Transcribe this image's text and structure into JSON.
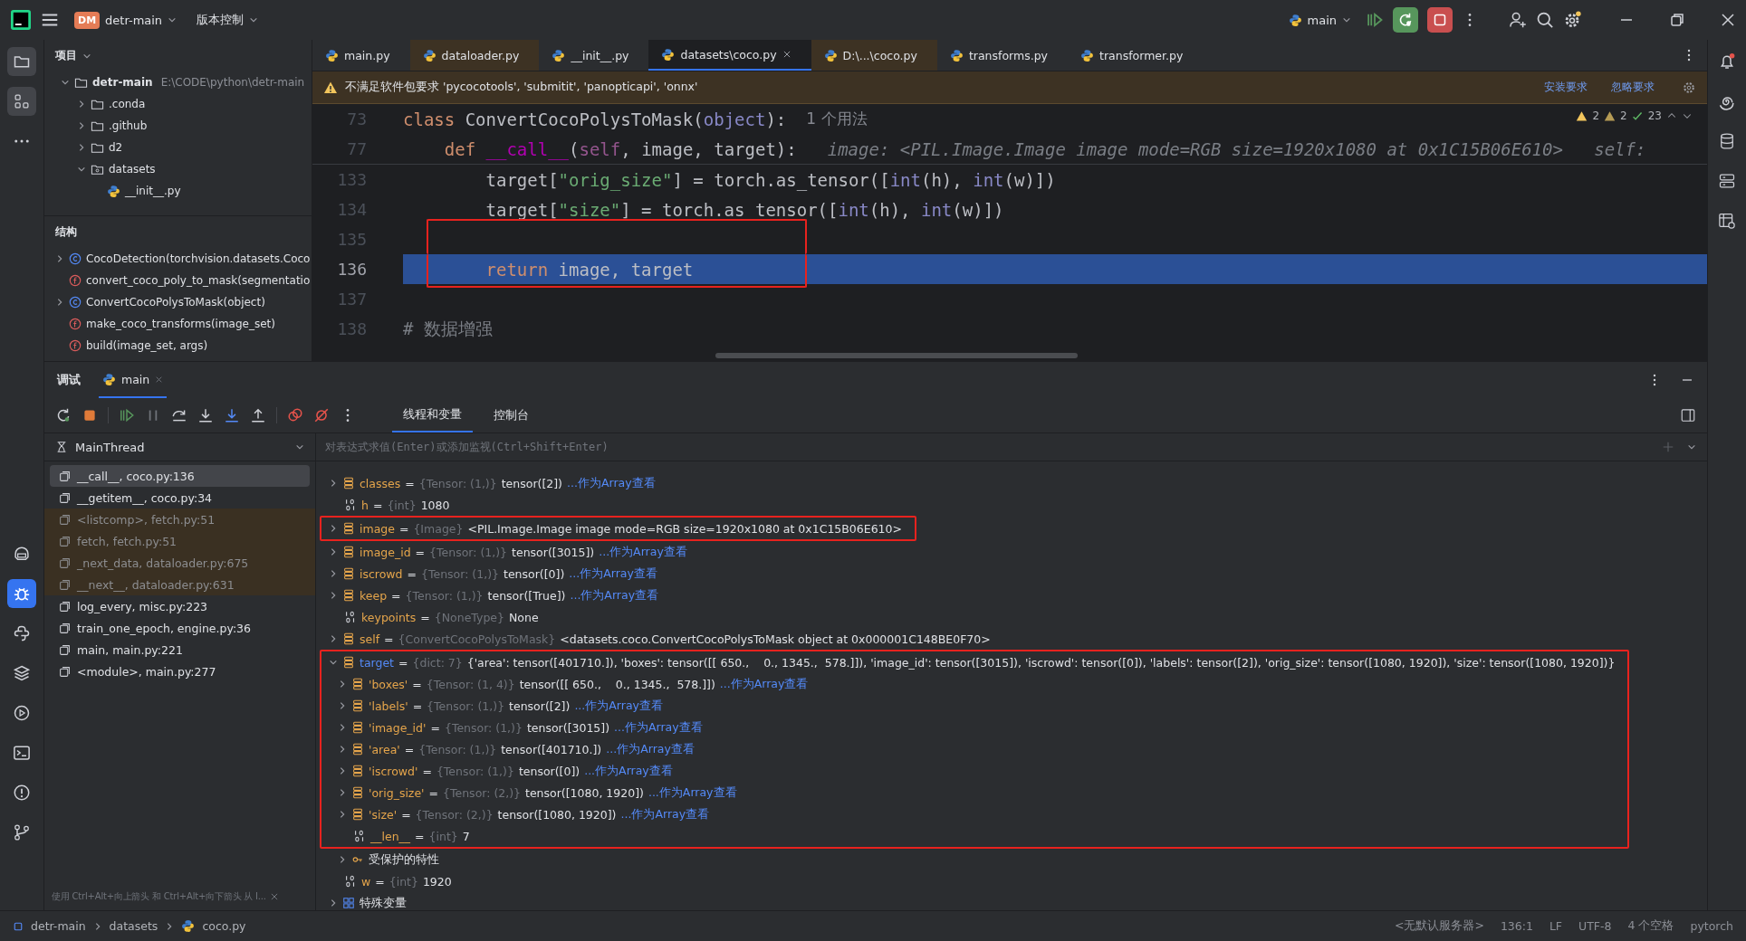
{
  "title_bar": {
    "project_badge": "DM",
    "project": "detr-main",
    "vcs": "版本控制",
    "run_config": "main"
  },
  "left_strip": {
    "top": [
      {
        "kind": "folder",
        "selected": true
      },
      {
        "kind": "structure",
        "selected": true
      },
      {
        "kind": "more",
        "selected": false
      }
    ],
    "bottom": [
      {
        "kind": "assistant",
        "selected": false
      },
      {
        "kind": "debug",
        "selected": true
      },
      {
        "kind": "console",
        "selected": false
      },
      {
        "kind": "layers",
        "selected": false
      },
      {
        "kind": "run",
        "selected": false
      },
      {
        "kind": "terminal",
        "selected": false
      },
      {
        "kind": "problems",
        "selected": false
      },
      {
        "kind": "git",
        "selected": false
      }
    ]
  },
  "right_strip": [
    {
      "kind": "bell"
    },
    {
      "kind": "spiral"
    },
    {
      "kind": "database"
    },
    {
      "kind": "server"
    },
    {
      "kind": "table"
    }
  ],
  "project_panel": {
    "title": "项目",
    "tree": [
      {
        "kind": "folder",
        "label": "detr-main",
        "path": "E:\\CODE\\python\\detr-main",
        "expanded": true,
        "children": [
          {
            "kind": "folder",
            "label": ".conda",
            "expanded": false
          },
          {
            "kind": "folder",
            "label": ".github",
            "expanded": false
          },
          {
            "kind": "folder",
            "label": "d2",
            "expanded": false
          },
          {
            "kind": "package",
            "label": "datasets",
            "expanded": true,
            "children": [
              {
                "kind": "file",
                "label": "__init__.py"
              }
            ]
          }
        ]
      }
    ]
  },
  "structure_panel": {
    "title": "结构",
    "items": [
      {
        "kind": "class",
        "label": "CocoDetection(torchvision.datasets.Coco",
        "expanded": false
      },
      {
        "kind": "function",
        "label": "convert_coco_poly_to_mask(segmentatio"
      },
      {
        "kind": "class",
        "label": "ConvertCocoPolysToMask(object)",
        "expanded": false
      },
      {
        "kind": "function",
        "label": "make_coco_transforms(image_set)"
      },
      {
        "kind": "function",
        "label": "build(image_set, args)"
      }
    ]
  },
  "editor": {
    "tabs": [
      {
        "label": "main.py",
        "selected": false,
        "library": false
      },
      {
        "label": "dataloader.py",
        "selected": false,
        "library": true
      },
      {
        "label": "__init__.py",
        "selected": false,
        "library": false
      },
      {
        "label": "datasets\\coco.py",
        "selected": true,
        "library": false
      },
      {
        "label": "D:\\...\\coco.py",
        "selected": false,
        "library": true
      },
      {
        "label": "transforms.py",
        "selected": false,
        "library": false
      },
      {
        "label": "transformer.py",
        "selected": false,
        "library": false
      }
    ],
    "banner": {
      "text": "不满足软件包要求 'pycocotools', 'submitit', 'panopticapi', 'onnx'",
      "actions": [
        "安装要求",
        "忽略要求"
      ]
    },
    "inspections": {
      "warnings": "2",
      "weak_warnings": "2",
      "checks": "23"
    },
    "sticky_lines": [
      {
        "number": "73",
        "tokens": [
          {
            "kind": "kw",
            "text": "class"
          },
          {
            "kind": "plain",
            "text": " ConvertCocoPolysToMask("
          },
          {
            "kind": "builtin",
            "text": "object"
          },
          {
            "kind": "plain",
            "text": "):"
          }
        ],
        "hint": {
          "kind": "usages",
          "text": "1 个用法"
        }
      },
      {
        "number": "77",
        "tokens": [
          {
            "kind": "kw",
            "text": "    def "
          },
          {
            "kind": "magic",
            "text": "__call__"
          },
          {
            "kind": "plain",
            "text": "("
          },
          {
            "kind": "self",
            "text": "self"
          },
          {
            "kind": "plain",
            "text": ", image, target):"
          }
        ],
        "hint": {
          "kind": "value",
          "text": "image: <PIL.Image.Image image mode=RGB size=1920x1080 at 0x1C15B06E610>   self:"
        }
      }
    ],
    "lines": [
      {
        "number": "133",
        "current": false,
        "highlight": false,
        "tokens": [
          {
            "kind": "plain",
            "text": "        target["
          },
          {
            "kind": "str",
            "text": "\"orig_size\""
          },
          {
            "kind": "plain",
            "text": "] = torch.as_tensor(["
          },
          {
            "kind": "builtin",
            "text": "int"
          },
          {
            "kind": "plain",
            "text": "(h), "
          },
          {
            "kind": "builtin",
            "text": "int"
          },
          {
            "kind": "plain",
            "text": "(w)])"
          }
        ]
      },
      {
        "number": "134",
        "current": false,
        "highlight": false,
        "tokens": [
          {
            "kind": "plain",
            "text": "        target["
          },
          {
            "kind": "str",
            "text": "\"size\""
          },
          {
            "kind": "plain",
            "text": "] = torch.as_tensor(["
          },
          {
            "kind": "builtin",
            "text": "int"
          },
          {
            "kind": "plain",
            "text": "(h), "
          },
          {
            "kind": "builtin",
            "text": "int"
          },
          {
            "kind": "plain",
            "text": "(w)])"
          }
        ]
      },
      {
        "number": "135",
        "current": false,
        "highlight": true
      },
      {
        "number": "136",
        "current": true,
        "highlight": true,
        "tokens": [
          {
            "kind": "kw",
            "text": "        return"
          },
          {
            "kind": "plain",
            "text": " image, target"
          }
        ]
      },
      {
        "number": "137",
        "current": false,
        "highlight": false
      },
      {
        "number": "138",
        "current": false,
        "highlight": false,
        "tokens": [
          {
            "kind": "comment",
            "text": "# 数据增强"
          }
        ]
      }
    ]
  },
  "debug": {
    "title": "调试",
    "tabs": [
      {
        "label": "main",
        "selected": true
      }
    ],
    "view_tabs": [
      {
        "label": "线程和变量",
        "selected": true
      },
      {
        "label": "控制台",
        "selected": false
      }
    ],
    "thread": "MainThread",
    "eval_placeholder": "对表达式求值(Enter)或添加监视(Ctrl+Shift+Enter)",
    "frames": [
      {
        "label": "__call__, coco.py:136",
        "selected": true,
        "library": false
      },
      {
        "label": "__getitem__, coco.py:34",
        "selected": false,
        "library": false
      },
      {
        "label": "<listcomp>, fetch.py:51",
        "selected": false,
        "library": true
      },
      {
        "label": "fetch, fetch.py:51",
        "selected": false,
        "library": true
      },
      {
        "label": "_next_data, dataloader.py:675",
        "selected": false,
        "library": true
      },
      {
        "label": "__next__, dataloader.py:631",
        "selected": false,
        "library": true
      },
      {
        "label": "log_every, misc.py:223",
        "selected": false,
        "library": false
      },
      {
        "label": "train_one_epoch, engine.py:36",
        "selected": false,
        "library": false
      },
      {
        "label": "main, main.py:221",
        "selected": false,
        "library": false
      },
      {
        "label": "<module>, main.py:277",
        "selected": false,
        "library": false
      }
    ],
    "hint": "使用 Ctrl+Alt+向上箭头 和 Ctrl+Alt+向下箭头 从 I...",
    "variables": [
      {
        "name": "classes",
        "operator": "=",
        "type": "{Tensor: (1,)}",
        "value": "tensor([2])",
        "link": "...作为Array查看",
        "kind": "object",
        "expanded": false,
        "changed": false,
        "highlight": false
      },
      {
        "name": "h",
        "operator": "=",
        "type": "{int}",
        "value": "1080",
        "kind": "scalar",
        "changed": false,
        "highlight": false
      },
      {
        "name": "image",
        "operator": "=",
        "type": "{Image}",
        "value": "<PIL.Image.Image image mode=RGB size=1920x1080 at 0x1C15B06E610>",
        "kind": "object",
        "expanded": false,
        "changed": false,
        "highlight": true
      },
      {
        "name": "image_id",
        "operator": "=",
        "type": "{Tensor: (1,)}",
        "value": "tensor([3015])",
        "link": "...作为Array查看",
        "kind": "object",
        "expanded": false,
        "changed": false,
        "highlight": false
      },
      {
        "name": "iscrowd",
        "operator": "=",
        "type": "{Tensor: (1,)}",
        "value": "tensor([0])",
        "link": "...作为Array查看",
        "kind": "object",
        "expanded": false,
        "changed": false,
        "highlight": false
      },
      {
        "name": "keep",
        "operator": "=",
        "type": "{Tensor: (1,)}",
        "value": "tensor([True])",
        "link": "...作为Array查看",
        "kind": "object",
        "expanded": false,
        "changed": false,
        "highlight": false
      },
      {
        "name": "keypoints",
        "operator": "=",
        "type": "{NoneType}",
        "value": "None",
        "kind": "scalar",
        "changed": false,
        "highlight": false
      },
      {
        "name": "self",
        "operator": "=",
        "type": "{ConvertCocoPolysToMask}",
        "value": "<datasets.coco.ConvertCocoPolysToMask object at 0x000001C148BE0F70>",
        "kind": "object",
        "expanded": false,
        "changed": false,
        "highlight": false
      },
      {
        "name": "target",
        "operator": "=",
        "type": "{dict: 7}",
        "value": "{'area': tensor([401710.]), 'boxes': tensor([[ 650.,    0., 1345.,  578.]]), 'image_id': tensor([3015]), 'iscrowd': tensor([0]), 'labels': tensor([2]), 'orig_size': tensor([1080, 1920]), 'size': tensor([1080, 1920])}",
        "kind": "object",
        "expanded": true,
        "changed": true,
        "highlight": true,
        "children": [
          {
            "name": "'boxes'",
            "operator": "=",
            "type": "{Tensor: (1, 4)}",
            "value": "tensor([[ 650.,    0., 1345.,  578.]])",
            "link": "...作为Array查看",
            "kind": "object",
            "expanded": false,
            "changed": false,
            "highlight": true
          },
          {
            "name": "'labels'",
            "operator": "=",
            "type": "{Tensor: (1,)}",
            "value": "tensor([2])",
            "link": "...作为Array查看",
            "kind": "object",
            "expanded": false,
            "changed": false,
            "highlight": true
          },
          {
            "name": "'image_id'",
            "operator": "=",
            "type": "{Tensor: (1,)}",
            "value": "tensor([3015])",
            "link": "...作为Array查看",
            "kind": "object",
            "expanded": false,
            "changed": false,
            "highlight": true
          },
          {
            "name": "'area'",
            "operator": "=",
            "type": "{Tensor: (1,)}",
            "value": "tensor([401710.])",
            "link": "...作为Array查看",
            "kind": "object",
            "expanded": false,
            "changed": false,
            "highlight": true
          },
          {
            "name": "'iscrowd'",
            "operator": "=",
            "type": "{Tensor: (1,)}",
            "value": "tensor([0])",
            "link": "...作为Array查看",
            "kind": "object",
            "expanded": false,
            "changed": false,
            "highlight": true
          },
          {
            "name": "'orig_size'",
            "operator": "=",
            "type": "{Tensor: (2,)}",
            "value": "tensor([1080, 1920])",
            "link": "...作为Array查看",
            "kind": "object",
            "expanded": false,
            "changed": false,
            "highlight": true
          },
          {
            "name": "'size'",
            "operator": "=",
            "type": "{Tensor: (2,)}",
            "value": "tensor([1080, 1920])",
            "link": "...作为Array查看",
            "kind": "object",
            "expanded": false,
            "changed": false,
            "highlight": true
          },
          {
            "name": "__len__",
            "operator": "=",
            "type": "{int}",
            "value": "7",
            "kind": "scalar",
            "changed": false,
            "highlight": true
          },
          {
            "name": "受保护的特性",
            "kind": "protected",
            "expanded": false,
            "changed": false,
            "highlight": false
          }
        ]
      },
      {
        "name": "w",
        "operator": "=",
        "type": "{int}",
        "value": "1920",
        "kind": "scalar",
        "changed": false,
        "highlight": false
      },
      {
        "name": "特殊变量",
        "kind": "special",
        "expanded": false,
        "changed": false,
        "highlight": false
      }
    ]
  },
  "status_bar": {
    "breadcrumbs": [
      {
        "kind": "module",
        "label": "detr-main"
      },
      {
        "kind": "folder",
        "label": "datasets"
      },
      {
        "kind": "python",
        "label": "coco.py"
      }
    ],
    "items": [
      "<无默认服务器>",
      "136:1",
      "LF",
      "UTF-8",
      "4 个空格",
      "pytorch"
    ]
  }
}
